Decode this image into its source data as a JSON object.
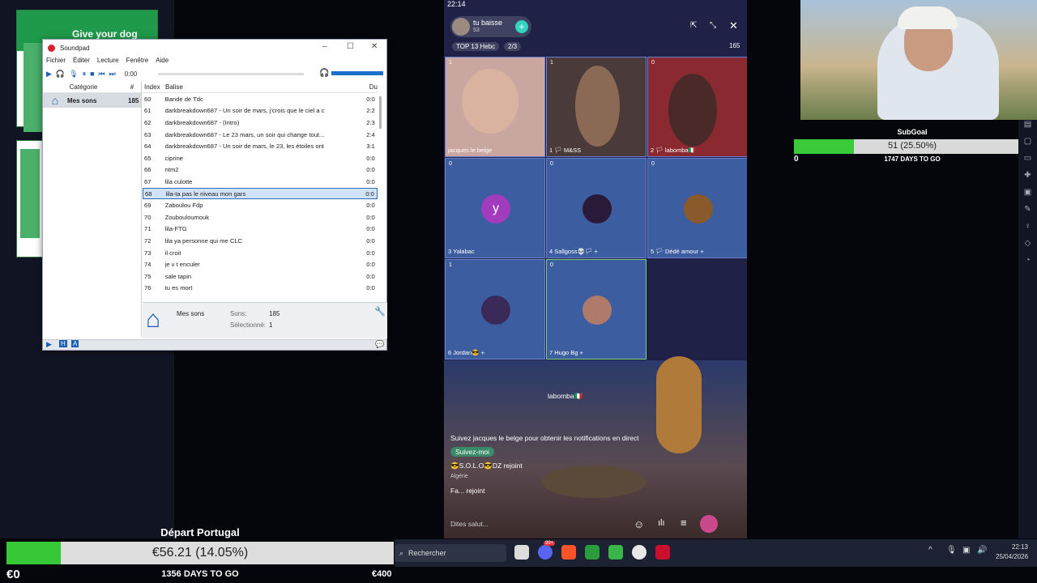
{
  "left_ad": {
    "text": "Give your dog"
  },
  "soundpad": {
    "title": "Soundpad",
    "menu": [
      "Fichier",
      "Éditer",
      "Lecture",
      "Fenêtre",
      "Aide"
    ],
    "time": "0:00",
    "cat_header": {
      "category": "Catégorie",
      "count": "#"
    },
    "category": {
      "name": "Mes sons",
      "count": "185"
    },
    "list_header": {
      "index": "Index",
      "title": "Balise",
      "duration": "Du"
    },
    "rows": [
      {
        "i": "60",
        "t": "Bande de Tdc",
        "d": "0:0"
      },
      {
        "i": "61",
        "t": "darkbreakdown687 - Un soir de mars, j'crois que le ciel a c",
        "d": "2:2"
      },
      {
        "i": "62",
        "t": "darkbreakdown687 - (Intro)",
        "d": "2:3"
      },
      {
        "i": "63",
        "t": "darkbreakdown687 - Le 23 mars, un soir qui change tout...",
        "d": "2:4"
      },
      {
        "i": "64",
        "t": "darkbreakdown687 - Un soir de mars, le 23, les étoiles ont",
        "d": "3:1"
      },
      {
        "i": "65",
        "t": "ciprine",
        "d": "0:0"
      },
      {
        "i": "66",
        "t": "ntm2",
        "d": "0:0"
      },
      {
        "i": "67",
        "t": "lila culotte",
        "d": "0:0"
      },
      {
        "i": "68",
        "t": "lila-ta pas le niveau mon gars",
        "d": "0:0",
        "sel": true
      },
      {
        "i": "69",
        "t": "Zaboulou Fdp",
        "d": "0:0"
      },
      {
        "i": "70",
        "t": "Zoubouloumouk",
        "d": "0:0"
      },
      {
        "i": "71",
        "t": "lila-FTG",
        "d": "0:0"
      },
      {
        "i": "72",
        "t": "lila ya personne qui me CLC",
        "d": "0:0"
      },
      {
        "i": "73",
        "t": "il croit",
        "d": "0:0"
      },
      {
        "i": "74",
        "t": "je v t enculer",
        "d": "0:0"
      },
      {
        "i": "75",
        "t": "sale tapin",
        "d": "0:0"
      },
      {
        "i": "76",
        "t": "tu es mort",
        "d": "0:0"
      }
    ],
    "footer": {
      "name": "Mes sons",
      "sounds_label": "Sons:",
      "sounds": "185",
      "selected_label": "Sélectionné:",
      "selected": "1"
    }
  },
  "phone": {
    "time": "22:14",
    "room_name": "tu baisse",
    "room_sub": "53",
    "rank": "TOP 13 Hebc",
    "progress": "2/3",
    "viewers": "165",
    "tiles": [
      {
        "n": "1",
        "name": "jacques le belge",
        "c": "1"
      },
      {
        "n": "1",
        "name": "1 🏳 M&SS",
        "c": "1"
      },
      {
        "n": "2",
        "name": "2 🏳 labomba🇮🇹",
        "c": "0"
      },
      {
        "n": "3",
        "name": "3 Yalabac",
        "c": "0",
        "letter": "y"
      },
      {
        "n": "4",
        "name": "4 Sallgoss💀🏳 +",
        "c": "0"
      },
      {
        "n": "5",
        "name": "5 🏳 Dédé amour +",
        "c": "0"
      },
      {
        "n": "6",
        "name": "6 Jordan😎 +",
        "c": "1"
      },
      {
        "n": "7",
        "name": "7 Hugo Bg +",
        "c": "0"
      }
    ],
    "chat_user": "labomba🇮🇹",
    "notice": "Suivez jacques le belge pour obtenir les notifications en direct",
    "follow": "Suivez-moi",
    "msg1": "😎S.O.L.O😎DZ rejoint",
    "msg2": "Algérie",
    "msg3": "Fa... rejoint",
    "input": "Dites salut..."
  },
  "subgoal": {
    "title": "SubGoal",
    "value": "51 (25.50%)",
    "min": "0",
    "max": "200",
    "days": "1747 DAYS TO GO",
    "fraction": 0.255
  },
  "donation": {
    "title": "Départ Portugal",
    "value": "€56.21 (14.05%)",
    "min": "€0",
    "max": "€400",
    "days": "1356 DAYS TO GO",
    "fraction": 0.1405
  },
  "taskbar": {
    "search": "Rechercher",
    "time": "22:13",
    "date": "25/04/2026",
    "badge": "99+"
  }
}
